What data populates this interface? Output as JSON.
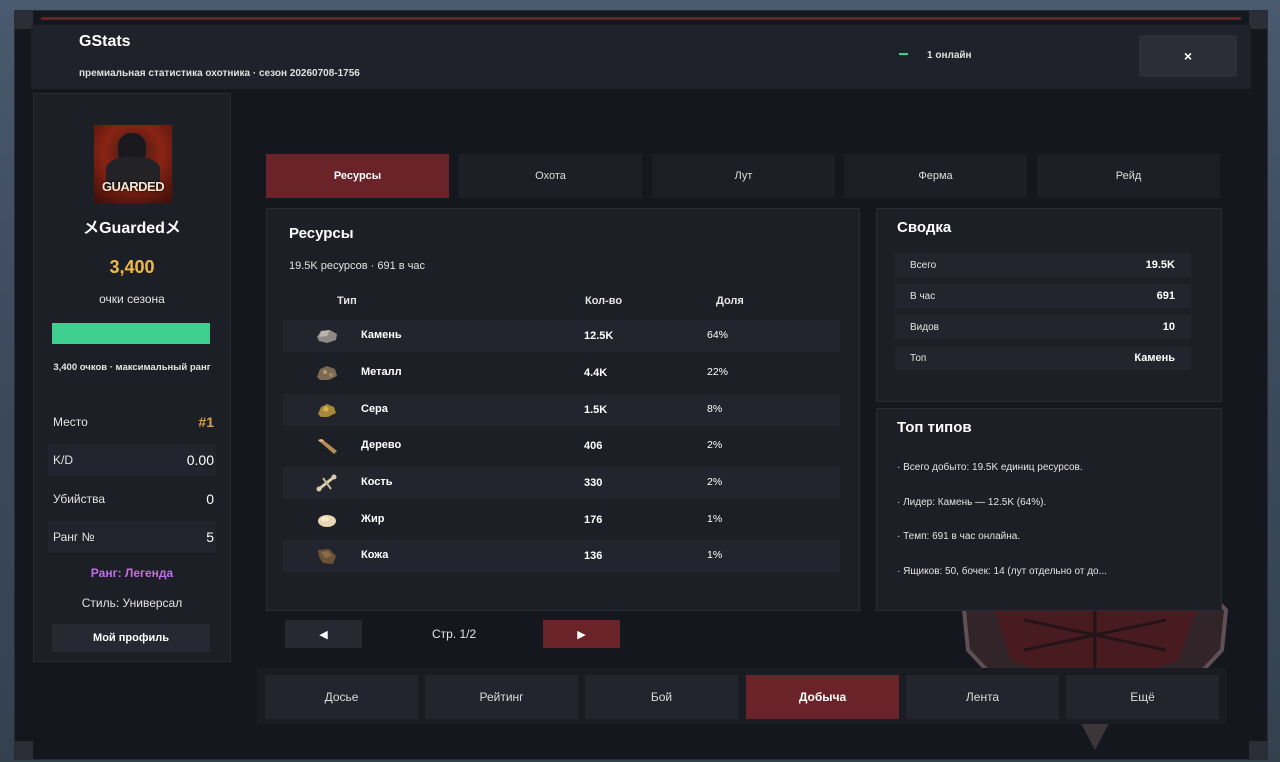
{
  "header": {
    "title": "GStats",
    "subtitle": "премиальная статистика охотника · сезон 20260708-1756",
    "online_text": "1 онлайн",
    "close_label": "×"
  },
  "profile": {
    "avatar_tag": "GUARDED",
    "name": "メGuardedメ",
    "points": "3,400",
    "points_label": "очки сезона",
    "progress_fraction": 1.0,
    "progress_color": "#3ecf8e",
    "rank_note": "3,400 очков · максимальный ранг",
    "stats": [
      {
        "label": "Место",
        "value": "#1"
      },
      {
        "label": "K/D",
        "value": "0.00"
      },
      {
        "label": "Убийства",
        "value": "0"
      },
      {
        "label": "Ранг №",
        "value": "5"
      }
    ],
    "rank_title": "Ранг: Легенда",
    "style": "Стиль: Универсал",
    "profile_button": "Мой профиль"
  },
  "tabs": [
    "Ресурсы",
    "Охота",
    "Лут",
    "Ферма",
    "Рейд"
  ],
  "active_tab": "Ресурсы",
  "resources": {
    "title": "Ресурсы",
    "subtitle": "19.5K ресурсов · 691 в час",
    "columns": [
      "Тип",
      "Кол-во",
      "Доля"
    ],
    "rows": [
      {
        "icon": "stone-icon",
        "name": "Камень",
        "qty": "12.5K",
        "share": "64%"
      },
      {
        "icon": "metal-ore-icon",
        "name": "Металл",
        "qty": "4.4K",
        "share": "22%"
      },
      {
        "icon": "sulfur-ore-icon",
        "name": "Сера",
        "qty": "1.5K",
        "share": "8%"
      },
      {
        "icon": "wood-icon",
        "name": "Дерево",
        "qty": "406",
        "share": "2%"
      },
      {
        "icon": "bone-icon",
        "name": "Кость",
        "qty": "330",
        "share": "2%"
      },
      {
        "icon": "fat-icon",
        "name": "Жир",
        "qty": "176",
        "share": "1%"
      },
      {
        "icon": "leather-icon",
        "name": "Кожа",
        "qty": "136",
        "share": "1%"
      }
    ]
  },
  "summary": {
    "title": "Сводка",
    "rows": [
      {
        "label": "Всего",
        "value": "19.5K"
      },
      {
        "label": "В час",
        "value": "691"
      },
      {
        "label": "Видов",
        "value": "10"
      },
      {
        "label": "Топ",
        "value": "Камень"
      }
    ]
  },
  "top_types": {
    "title": "Топ типов",
    "lines": [
      "· Всего добыто: 19.5K единиц ресурсов.",
      "· Лидер: Камень — 12.5K (64%).",
      "· Темп: 691 в час онлайна.",
      "· Ящиков: 50, бочек: 14 (лут отдельно от до..."
    ]
  },
  "pager": {
    "prev": "◀",
    "next": "▶",
    "label": "Стр. 1/2"
  },
  "bottom_nav": [
    "Досье",
    "Рейтинг",
    "Бой",
    "Добыча",
    "Лента",
    "Ещё"
  ],
  "active_bottom": "Добыча",
  "colors": {
    "accent": "#6a2328",
    "points": "#f0b84a",
    "online": "#3ecf8e",
    "rank": "#c06ee8"
  }
}
